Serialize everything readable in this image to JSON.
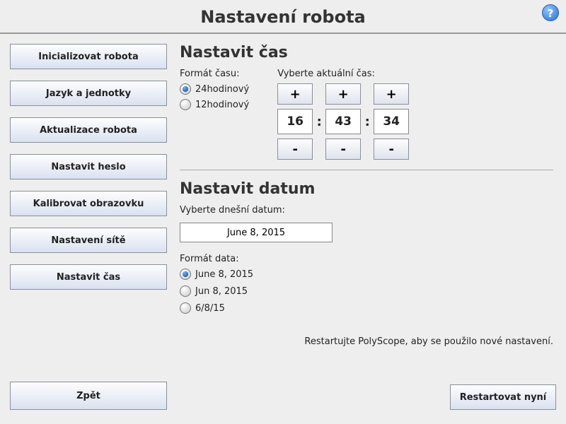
{
  "header": {
    "title": "Nastavení robota",
    "help": "?"
  },
  "sidebar": {
    "items": [
      "Inicializovat robota",
      "Jazyk a jednotky",
      "Aktualizace robota",
      "Nastavit heslo",
      "Kalibrovat obrazovku",
      "Nastavení sítě",
      "Nastavit čas"
    ]
  },
  "time": {
    "title": "Nastavit čas",
    "format_label": "Formát času:",
    "format_options": {
      "h24": "24hodinový",
      "h12": "12hodinový"
    },
    "select_label": "Vyberte aktuální čas:",
    "plus": "+",
    "minus": "-",
    "colon": ":",
    "h": "16",
    "m": "43",
    "s": "34"
  },
  "date": {
    "title": "Nastavit datum",
    "select_label": "Vyberte dnešní datum:",
    "value": "June 8, 2015",
    "format_label": "Formát data:",
    "options": {
      "long": "June 8, 2015",
      "med": "Jun 8, 2015",
      "short": "6/8/15"
    }
  },
  "restart": {
    "note": "Restartujte PolyScope, aby se použilo nové nastavení.",
    "button": "Restartovat nyní"
  },
  "back": "Zpět"
}
